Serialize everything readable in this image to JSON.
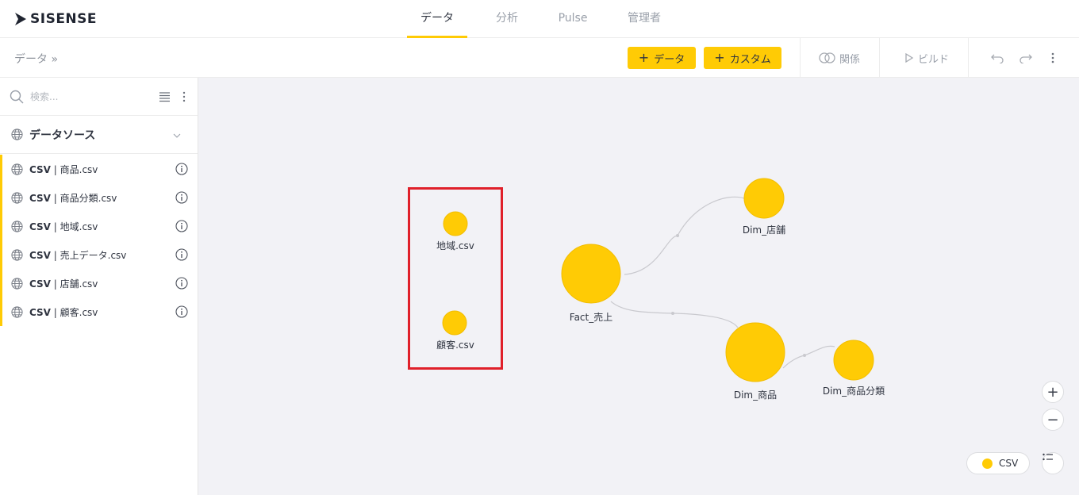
{
  "app": {
    "logo_text": "SISENSE"
  },
  "nav": [
    {
      "label": "データ",
      "active": true
    },
    {
      "label": "分析",
      "active": false
    },
    {
      "label": "Pulse",
      "active": false
    },
    {
      "label": "管理者",
      "active": false
    }
  ],
  "toolbar": {
    "breadcrumb": "データ »",
    "add_data_label": "データ",
    "add_custom_label": "カスタム",
    "relations_label": "関係",
    "build_label": "ビルド"
  },
  "sidebar": {
    "search_placeholder": "検索...",
    "section_title": "データソース",
    "items": [
      {
        "type": "CSV",
        "name": "商品.csv"
      },
      {
        "type": "CSV",
        "name": "商品分類.csv"
      },
      {
        "type": "CSV",
        "name": "地域.csv"
      },
      {
        "type": "CSV",
        "name": "売上データ.csv"
      },
      {
        "type": "CSV",
        "name": "店舗.csv"
      },
      {
        "type": "CSV",
        "name": "顧客.csv"
      }
    ]
  },
  "canvas": {
    "nodes": {
      "region": "地域.csv",
      "customer": "顧客.csv",
      "fact": "Fact_売上",
      "store": "Dim_店舗",
      "product": "Dim_商品",
      "category": "Dim_商品分類"
    },
    "legend_label": "CSV",
    "zoom_in": "+",
    "zoom_out": "−"
  },
  "colors": {
    "accent": "#ffcb05",
    "highlight_box": "#e0202a"
  }
}
